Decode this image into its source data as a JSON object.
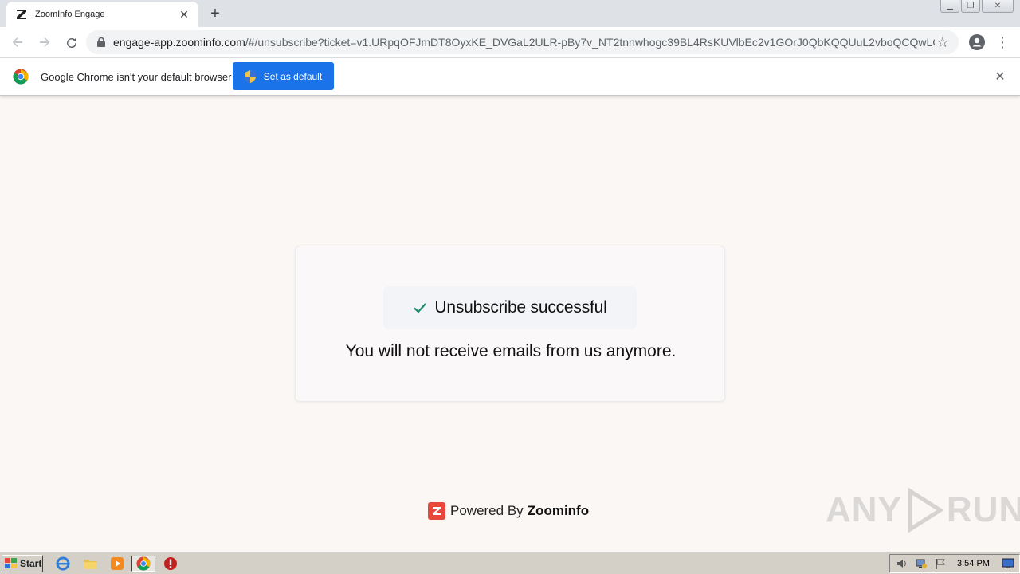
{
  "browser": {
    "tab_title": "ZoomInfo Engage",
    "url_host": "engage-app.zoominfo.com",
    "url_path": "/#/unsubscribe?ticket=v1.URpqOFJmDT8OyxKE_DVGaL2ULR-pBy7v_NT2tnnwhogc39BL4RsKUVlbEc2v1GOrJ0QbKQQUuL2vboQCQwLQ..."
  },
  "infobar": {
    "message": "Google Chrome isn't your default browser",
    "set_default_label": "Set as default"
  },
  "card": {
    "title": "Unsubscribe successful",
    "message": "You will not receive emails from us anymore."
  },
  "footer": {
    "powered_by": "Powered By",
    "brand": "Zoominfo"
  },
  "watermark": {
    "left": "ANY",
    "right": "RUN"
  },
  "taskbar": {
    "start_label": "Start",
    "clock": "3:54 PM"
  },
  "colors": {
    "accent": "#1a73e8",
    "success_check": "#1f8a70",
    "brand_red": "#e8473d",
    "page_bg": "#faf7f5"
  },
  "icons": [
    "zoominfo-favicon-icon",
    "close-icon",
    "plus-icon",
    "back-arrow-icon",
    "forward-arrow-icon",
    "reload-icon",
    "lock-icon",
    "star-icon",
    "profile-icon",
    "kebab-menu-icon",
    "chrome-logo-icon",
    "shield-icon",
    "check-icon",
    "zoominfo-logo-icon",
    "windows-flag-icon",
    "ie-icon",
    "folder-icon",
    "media-player-icon",
    "chrome-taskbar-icon",
    "stop-icon",
    "speaker-icon",
    "network-icon",
    "action-center-flag-icon",
    "show-desktop-icon"
  ]
}
